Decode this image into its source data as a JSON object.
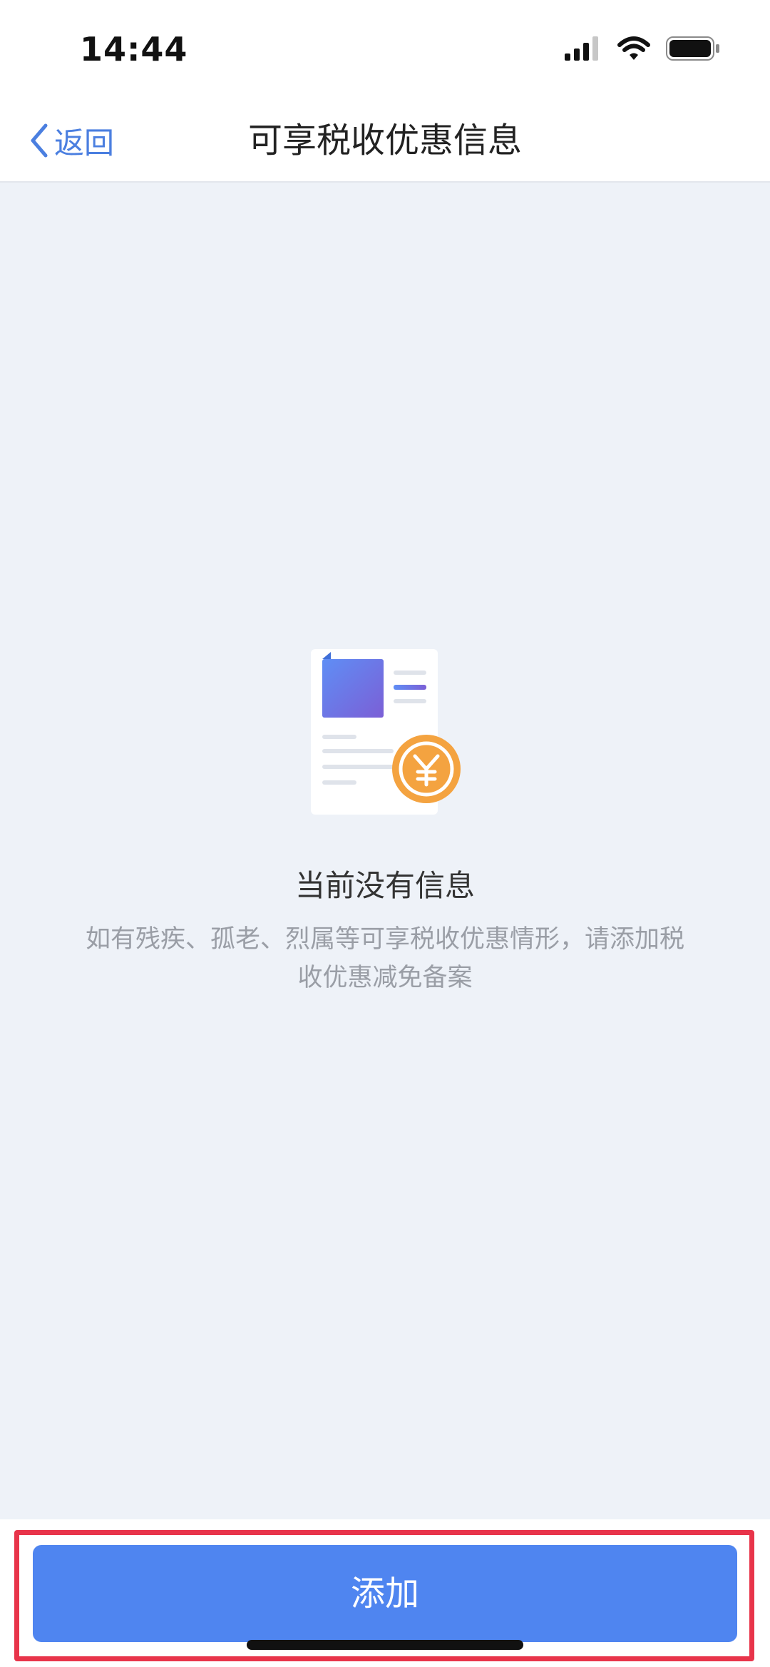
{
  "status_bar": {
    "time": "14:44",
    "icons": [
      "signal-icon",
      "wifi-icon",
      "battery-icon"
    ]
  },
  "nav": {
    "back_label": "返回",
    "title": "可享税收优惠信息"
  },
  "empty_state": {
    "icon": "document-yuan-icon",
    "title": "当前没有信息",
    "description": "如有残疾、孤老、烈属等可享税收优惠情形，请添加税收优惠减免备案"
  },
  "footer": {
    "add_label": "添加"
  },
  "colors": {
    "accent": "#4f85f0",
    "back_link": "#4b7fe0",
    "highlight_border": "#e8344a",
    "page_background": "#eef2f8",
    "coin": "#f4a340"
  }
}
